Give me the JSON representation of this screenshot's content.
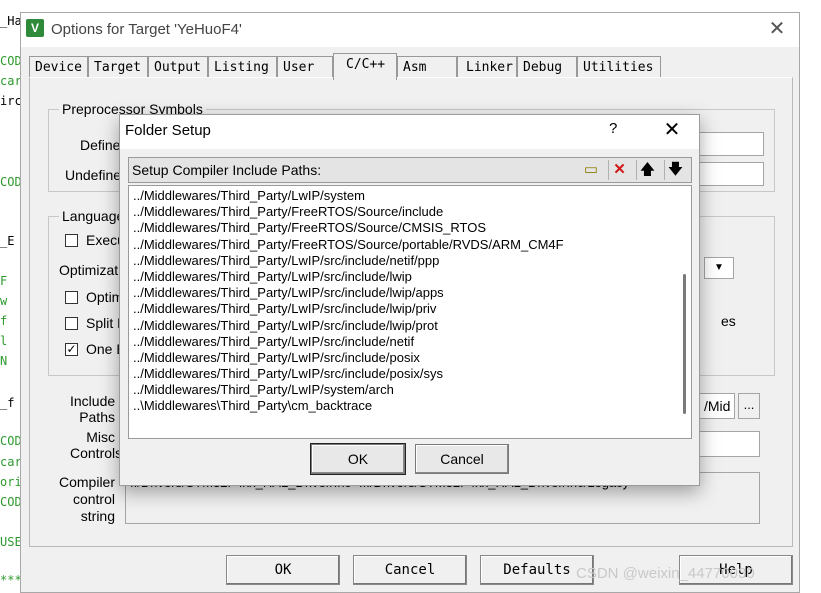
{
  "editor_strip": [
    "_Ha",
    "COD",
    "car",
    "irc",
    "COD",
    "_E",
    "F",
    "w",
    "f",
    "l",
    "N",
    "_f",
    "COD",
    "car",
    "ori",
    "COD",
    "USE",
    "***"
  ],
  "options_window": {
    "title": "Options for Target 'YeHuoF4'",
    "close_glyph": "✕",
    "tabs": [
      "Device",
      "Target",
      "Output",
      "Listing",
      "User",
      "C/C++",
      "Asm",
      "Linker",
      "Debug",
      "Utilities"
    ],
    "active_tab": "C/C++",
    "preprocessor": {
      "group_label": "Preprocessor Symbols",
      "define_label": "Define:",
      "undefine_label": "Undefine:"
    },
    "language": {
      "group_label": "Language",
      "execute_label": "Execu",
      "optimization_label": "Optimizatio",
      "optimize_label": "Optimi",
      "split_label": "Split L",
      "one_label": "One E",
      "one_check_glyph": "✓",
      "right_text": "es"
    },
    "include_paths": {
      "label_line1": "Include",
      "label_line2": "Paths",
      "value_fragment": "/Mid",
      "browse_label": "..."
    },
    "misc": {
      "label_line1": "Misc",
      "label_line2": "Controls"
    },
    "compiler": {
      "label_line1": "Compiler",
      "label_line2": "control",
      "label_line3": "string",
      "value_fragment": "../Drivers/STM32F4xx_HAL_Driver/Inc -I../Drivers/STM32F4xx_HAL_Driver/Inc/Legacy -"
    },
    "buttons": {
      "ok": "OK",
      "cancel": "Cancel",
      "defaults": "Defaults",
      "help": "Help"
    }
  },
  "folder_setup": {
    "title": "Folder Setup",
    "help_glyph": "?",
    "close_glyph": "✕",
    "list_label": "Setup Compiler Include Paths:",
    "toolbar_icons": [
      "new-folder-icon",
      "delete-icon",
      "move-up-icon",
      "move-down-icon"
    ],
    "toolbar_glyphs": {
      "new": "▭",
      "delete": "✕",
      "up": "🡅",
      "down": "🡇"
    },
    "paths": [
      "../Middlewares/Third_Party/LwIP/system",
      "../Middlewares/Third_Party/FreeRTOS/Source/include",
      "../Middlewares/Third_Party/FreeRTOS/Source/CMSIS_RTOS",
      "../Middlewares/Third_Party/FreeRTOS/Source/portable/RVDS/ARM_CM4F",
      "../Middlewares/Third_Party/LwIP/src/include/netif/ppp",
      "../Middlewares/Third_Party/LwIP/src/include/lwip",
      "../Middlewares/Third_Party/LwIP/src/include/lwip/apps",
      "../Middlewares/Third_Party/LwIP/src/include/lwip/priv",
      "../Middlewares/Third_Party/LwIP/src/include/lwip/prot",
      "../Middlewares/Third_Party/LwIP/src/include/netif",
      "../Middlewares/Third_Party/LwIP/src/include/posix",
      "../Middlewares/Third_Party/LwIP/src/include/posix/sys",
      "../Middlewares/Third_Party/LwIP/system/arch",
      "..\\Middlewares\\Third_Party\\cm_backtrace"
    ],
    "buttons": {
      "ok": "OK",
      "cancel": "Cancel"
    }
  },
  "watermark": "CSDN @weixin_44770030"
}
